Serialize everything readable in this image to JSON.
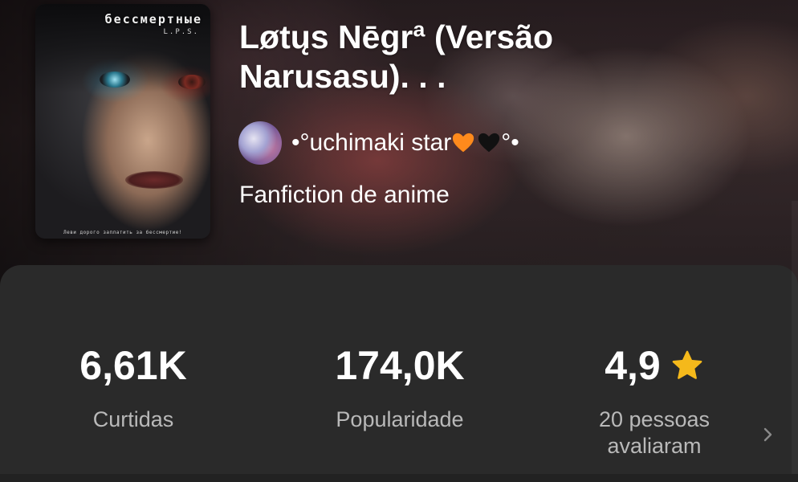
{
  "cover": {
    "title": "бессмертные",
    "subtitle": "L.P.S.",
    "footer": "Леви дорого заплатить за бессмертие!"
  },
  "story": {
    "title": "Løtųs Nēgrª (Versão Narusasu). . .",
    "author": "•°uchimaki star",
    "author_suffix": "°•",
    "category": "Fanfiction de anime"
  },
  "stats": {
    "likes": {
      "value": "6,61K",
      "label": "Curtidas"
    },
    "popularity": {
      "value": "174,0K",
      "label": "Popularidade"
    },
    "rating": {
      "value": "4,9",
      "label_line1": "20 pessoas",
      "label_line2": "avaliaram"
    }
  },
  "colors": {
    "panel": "#2a2a2a",
    "star": "#f5b91b",
    "orange_heart": "#ff8a1c",
    "black_heart": "#111111",
    "muted_text": "#b9b9b9"
  },
  "icons": [
    "orange-heart-icon",
    "black-heart-icon",
    "star-icon",
    "chevron-right-icon"
  ]
}
